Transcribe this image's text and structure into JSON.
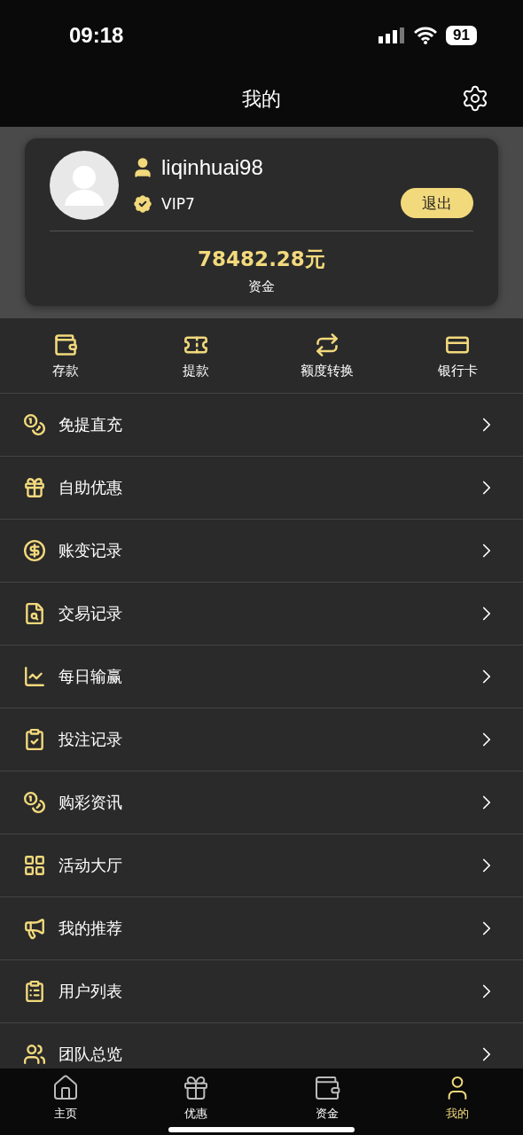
{
  "status_bar": {
    "time": "09:18",
    "battery": "91"
  },
  "header": {
    "title": "我的"
  },
  "profile": {
    "username": "liqinhuai98",
    "vip": "VIP7",
    "logout": "退出",
    "balance": "78482.28元",
    "balance_label": "资金"
  },
  "quick_actions": [
    {
      "label": "存款"
    },
    {
      "label": "提款"
    },
    {
      "label": "额度转换"
    },
    {
      "label": "银行卡"
    }
  ],
  "menu": [
    {
      "label": "免提直充"
    },
    {
      "label": "自助优惠"
    },
    {
      "label": "账变记录"
    },
    {
      "label": "交易记录"
    },
    {
      "label": "每日输赢"
    },
    {
      "label": "投注记录"
    },
    {
      "label": "购彩资讯"
    },
    {
      "label": "活动大厅"
    },
    {
      "label": "我的推荐"
    },
    {
      "label": "用户列表"
    },
    {
      "label": "团队总览"
    }
  ],
  "tab_bar": [
    {
      "label": "主页",
      "selected": false
    },
    {
      "label": "优惠",
      "selected": false
    },
    {
      "label": "资金",
      "selected": false
    },
    {
      "label": "我的",
      "selected": true
    }
  ]
}
